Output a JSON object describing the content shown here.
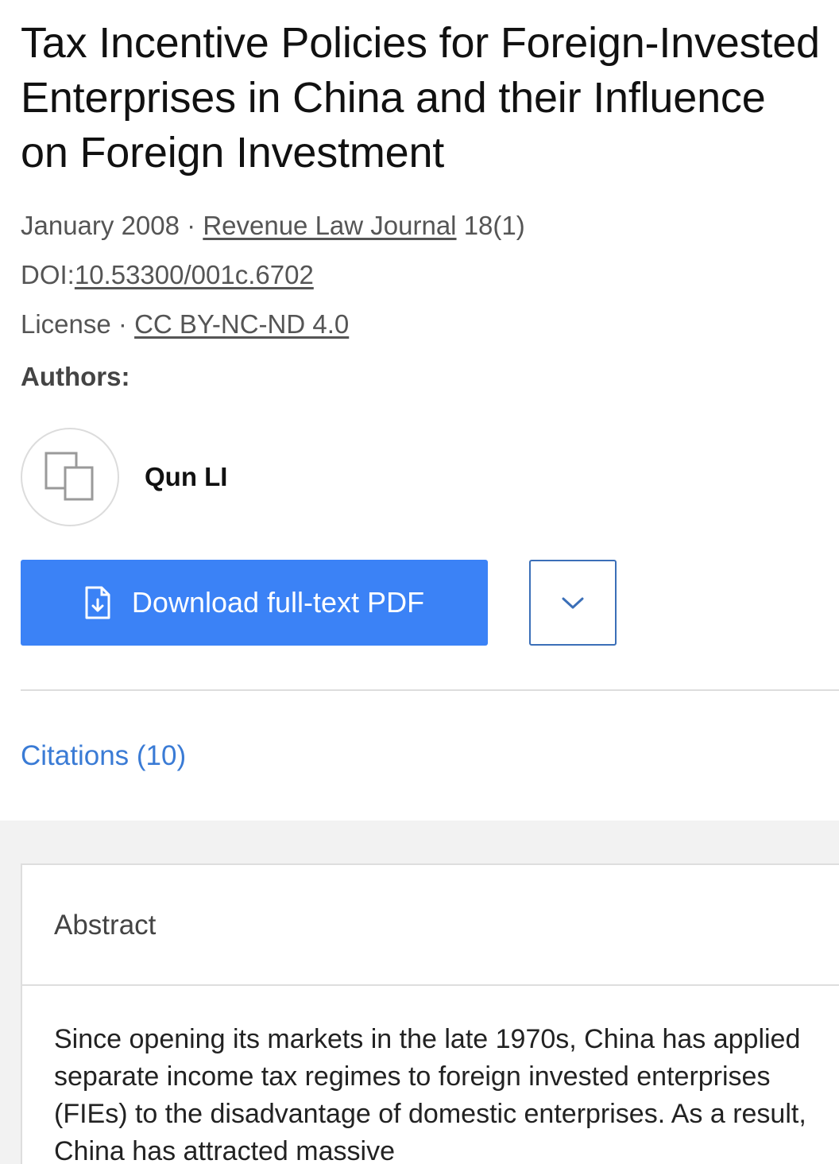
{
  "article": {
    "title": "Tax Incentive Policies for Foreign-Invested Enterprises in China and their Influence on Foreign Investment",
    "date": "January 2008",
    "separator": " · ",
    "journal": "Revenue Law Journal",
    "issue": " 18(1)",
    "doi_label": "DOI:",
    "doi": "10.53300/001c.6702",
    "license_label": "License · ",
    "license": "CC BY-NC-ND 4.0"
  },
  "authors": {
    "label": "Authors:",
    "list": [
      {
        "name": "Qun LI",
        "avatar_icon": "placeholder-avatar-icon"
      }
    ]
  },
  "actions": {
    "download_label": "Download full-text PDF",
    "download_icon": "pdf-download-icon",
    "more_icon": "chevron-down-icon"
  },
  "citations": {
    "label": "Citations (10)"
  },
  "abstract": {
    "heading": "Abstract",
    "text": "Since opening its markets in the late 1970s, China has applied separate income tax regimes to foreign invested enterprises (FIEs) to the disadvantage of domestic enterprises. As a result, China has attracted massive"
  },
  "colors": {
    "primary_button": "#3b82f6",
    "link_blue": "#3a7bd5",
    "background_gray": "#f2f2f2"
  }
}
